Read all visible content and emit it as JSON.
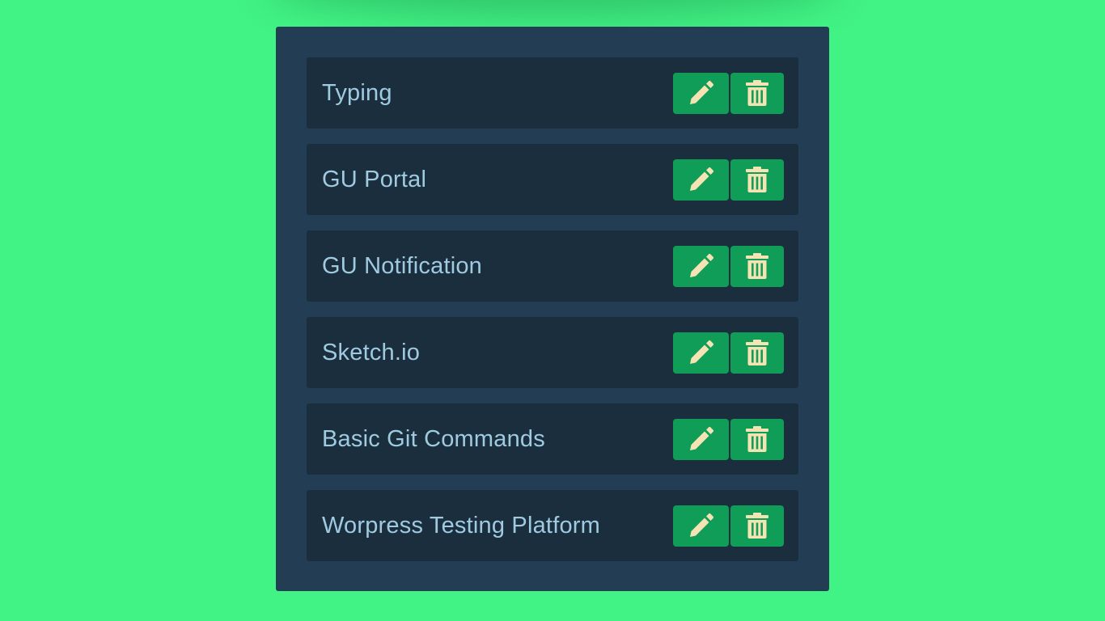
{
  "colors": {
    "background": "#41f284",
    "panel": "#233e54",
    "item": "#1a2e3e",
    "text": "#9fcae0",
    "button": "#0f9d58",
    "icon": "#f5e3b3"
  },
  "items": [
    {
      "label": "Typing",
      "edit_icon": "pencil-icon",
      "delete_icon": "trash-icon"
    },
    {
      "label": "GU Portal",
      "edit_icon": "pencil-icon",
      "delete_icon": "trash-icon"
    },
    {
      "label": "GU Notification",
      "edit_icon": "pencil-icon",
      "delete_icon": "trash-icon"
    },
    {
      "label": "Sketch.io",
      "edit_icon": "pencil-icon",
      "delete_icon": "trash-icon"
    },
    {
      "label": "Basic Git Commands",
      "edit_icon": "pencil-icon",
      "delete_icon": "trash-icon"
    },
    {
      "label": "Worpress Testing Platform",
      "edit_icon": "pencil-icon",
      "delete_icon": "trash-icon"
    }
  ]
}
